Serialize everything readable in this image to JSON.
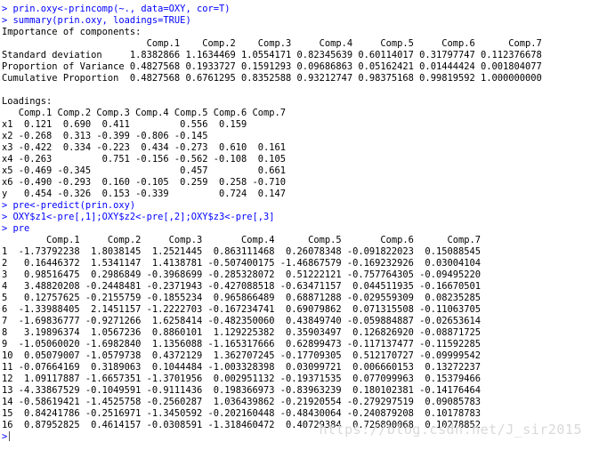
{
  "console": {
    "lines": [
      {
        "type": "input",
        "text": "> prin.oxy<-princomp(~., data=OXY, cor=T)"
      },
      {
        "type": "input",
        "text": "> summary(prin.oxy, loadings=TRUE)"
      },
      {
        "type": "output",
        "text": "Importance of components:"
      },
      {
        "type": "output",
        "text": "                          Comp.1    Comp.2    Comp.3     Comp.4     Comp.5     Comp.6      Comp.7"
      },
      {
        "type": "output",
        "text": "Standard deviation     1.8382866 1.1634469 1.0554171 0.82345639 0.60114017 0.31797747 0.112376678"
      },
      {
        "type": "output",
        "text": "Proportion of Variance 0.4827568 0.1933727 0.1591293 0.09686863 0.05162421 0.01444424 0.001804077"
      },
      {
        "type": "output",
        "text": "Cumulative Proportion  0.4827568 0.6761295 0.8352588 0.93212747 0.98375168 0.99819592 1.000000000"
      },
      {
        "type": "blank",
        "text": ""
      },
      {
        "type": "output",
        "text": "Loadings:"
      },
      {
        "type": "output",
        "text": "   Comp.1 Comp.2 Comp.3 Comp.4 Comp.5 Comp.6 Comp.7"
      },
      {
        "type": "output",
        "text": "x1  0.121  0.690  0.411         0.556  0.159       "
      },
      {
        "type": "output",
        "text": "x2 -0.268  0.313 -0.399 -0.806 -0.145              "
      },
      {
        "type": "output",
        "text": "x3 -0.422  0.334 -0.223  0.434 -0.273  0.610  0.161"
      },
      {
        "type": "output",
        "text": "x4 -0.263         0.751 -0.156 -0.562 -0.108  0.105"
      },
      {
        "type": "output",
        "text": "x5 -0.469 -0.345                0.457         0.661"
      },
      {
        "type": "output",
        "text": "x6 -0.490 -0.293  0.160 -0.105  0.259  0.258 -0.710"
      },
      {
        "type": "output",
        "text": "y   0.454 -0.326  0.153 -0.339         0.724  0.147"
      },
      {
        "type": "input",
        "text": "> pre<-predict(prin.oxy)"
      },
      {
        "type": "input",
        "text": "> OXY$z1<-pre[,1];OXY$z2<-pre[,2];OXY$z3<-pre[,3]"
      },
      {
        "type": "input",
        "text": "> pre"
      },
      {
        "type": "output",
        "text": "        Comp.1     Comp.2     Comp.3       Comp.4      Comp.5       Comp.6      Comp.7"
      },
      {
        "type": "output",
        "text": "1  -1.73792238  1.8038145  1.2521445  0.863111468  0.26078348 -0.091822023  0.15088545"
      },
      {
        "type": "output",
        "text": "2   0.16446372  1.5341147  1.4138781 -0.507400175 -1.46867579 -0.169232926  0.03004104"
      },
      {
        "type": "output",
        "text": "3   0.98516475  0.2986849 -0.3968699 -0.285328072  0.51222121 -0.757764305 -0.09495220"
      },
      {
        "type": "output",
        "text": "4   3.48820208 -0.2448481 -0.2371943 -0.427088518 -0.63471157  0.044511935 -0.16670501"
      },
      {
        "type": "output",
        "text": "5   0.12757625 -0.2155759 -0.1855234  0.965866489  0.68871288 -0.029559309  0.08235285"
      },
      {
        "type": "output",
        "text": "6  -1.33988405  2.1451157 -1.2222703 -0.167234741  0.69079862  0.071315508 -0.11063705"
      },
      {
        "type": "output",
        "text": "7  -1.69836777 -0.9271266  1.6258414 -0.482350060  0.43849740 -0.059884887 -0.02653614"
      },
      {
        "type": "output",
        "text": "8   3.19896374  1.0567236  0.8860101  1.129225382  0.35903497  0.126826920 -0.08871725"
      },
      {
        "type": "output",
        "text": "9  -1.05060020 -1.6982840  1.1356088 -1.165317666  0.62899473 -0.117137477 -0.11592285"
      },
      {
        "type": "output",
        "text": "10  0.05079007 -1.0579738  0.4372129  1.362707245 -0.17709305  0.512170727 -0.09999542"
      },
      {
        "type": "output",
        "text": "11 -0.07664169  0.3189063  0.1044484 -1.003328398  0.03099721  0.006660153  0.13272237"
      },
      {
        "type": "output",
        "text": "12  1.09117887 -1.6657351 -1.3701956  0.002951132 -0.19371535  0.077099963  0.15379466"
      },
      {
        "type": "output",
        "text": "13 -4.33867529 -0.1049591 -0.9111436  0.198366973 -0.83963239  0.180102381 -0.14176464"
      },
      {
        "type": "output",
        "text": "14 -0.58619421 -1.4525758 -0.2560287  1.036439862 -0.21920554 -0.279297519  0.09085783"
      },
      {
        "type": "output",
        "text": "15  0.84241786 -0.2516971 -1.3450592 -0.202160448 -0.48430064 -0.240879208  0.10178783"
      },
      {
        "type": "output",
        "text": "16  0.87952825  0.4614157 -0.0308591 -1.318460472  0.40729384  0.726890068  0.10278852"
      }
    ],
    "prompt": ">"
  },
  "watermark": {
    "text": "https://blog.csdn.net/J_sir2015"
  },
  "colors": {
    "input": "#0000ff",
    "output": "#000000",
    "background": "#ffffff",
    "watermark": "#d9d9d9"
  }
}
